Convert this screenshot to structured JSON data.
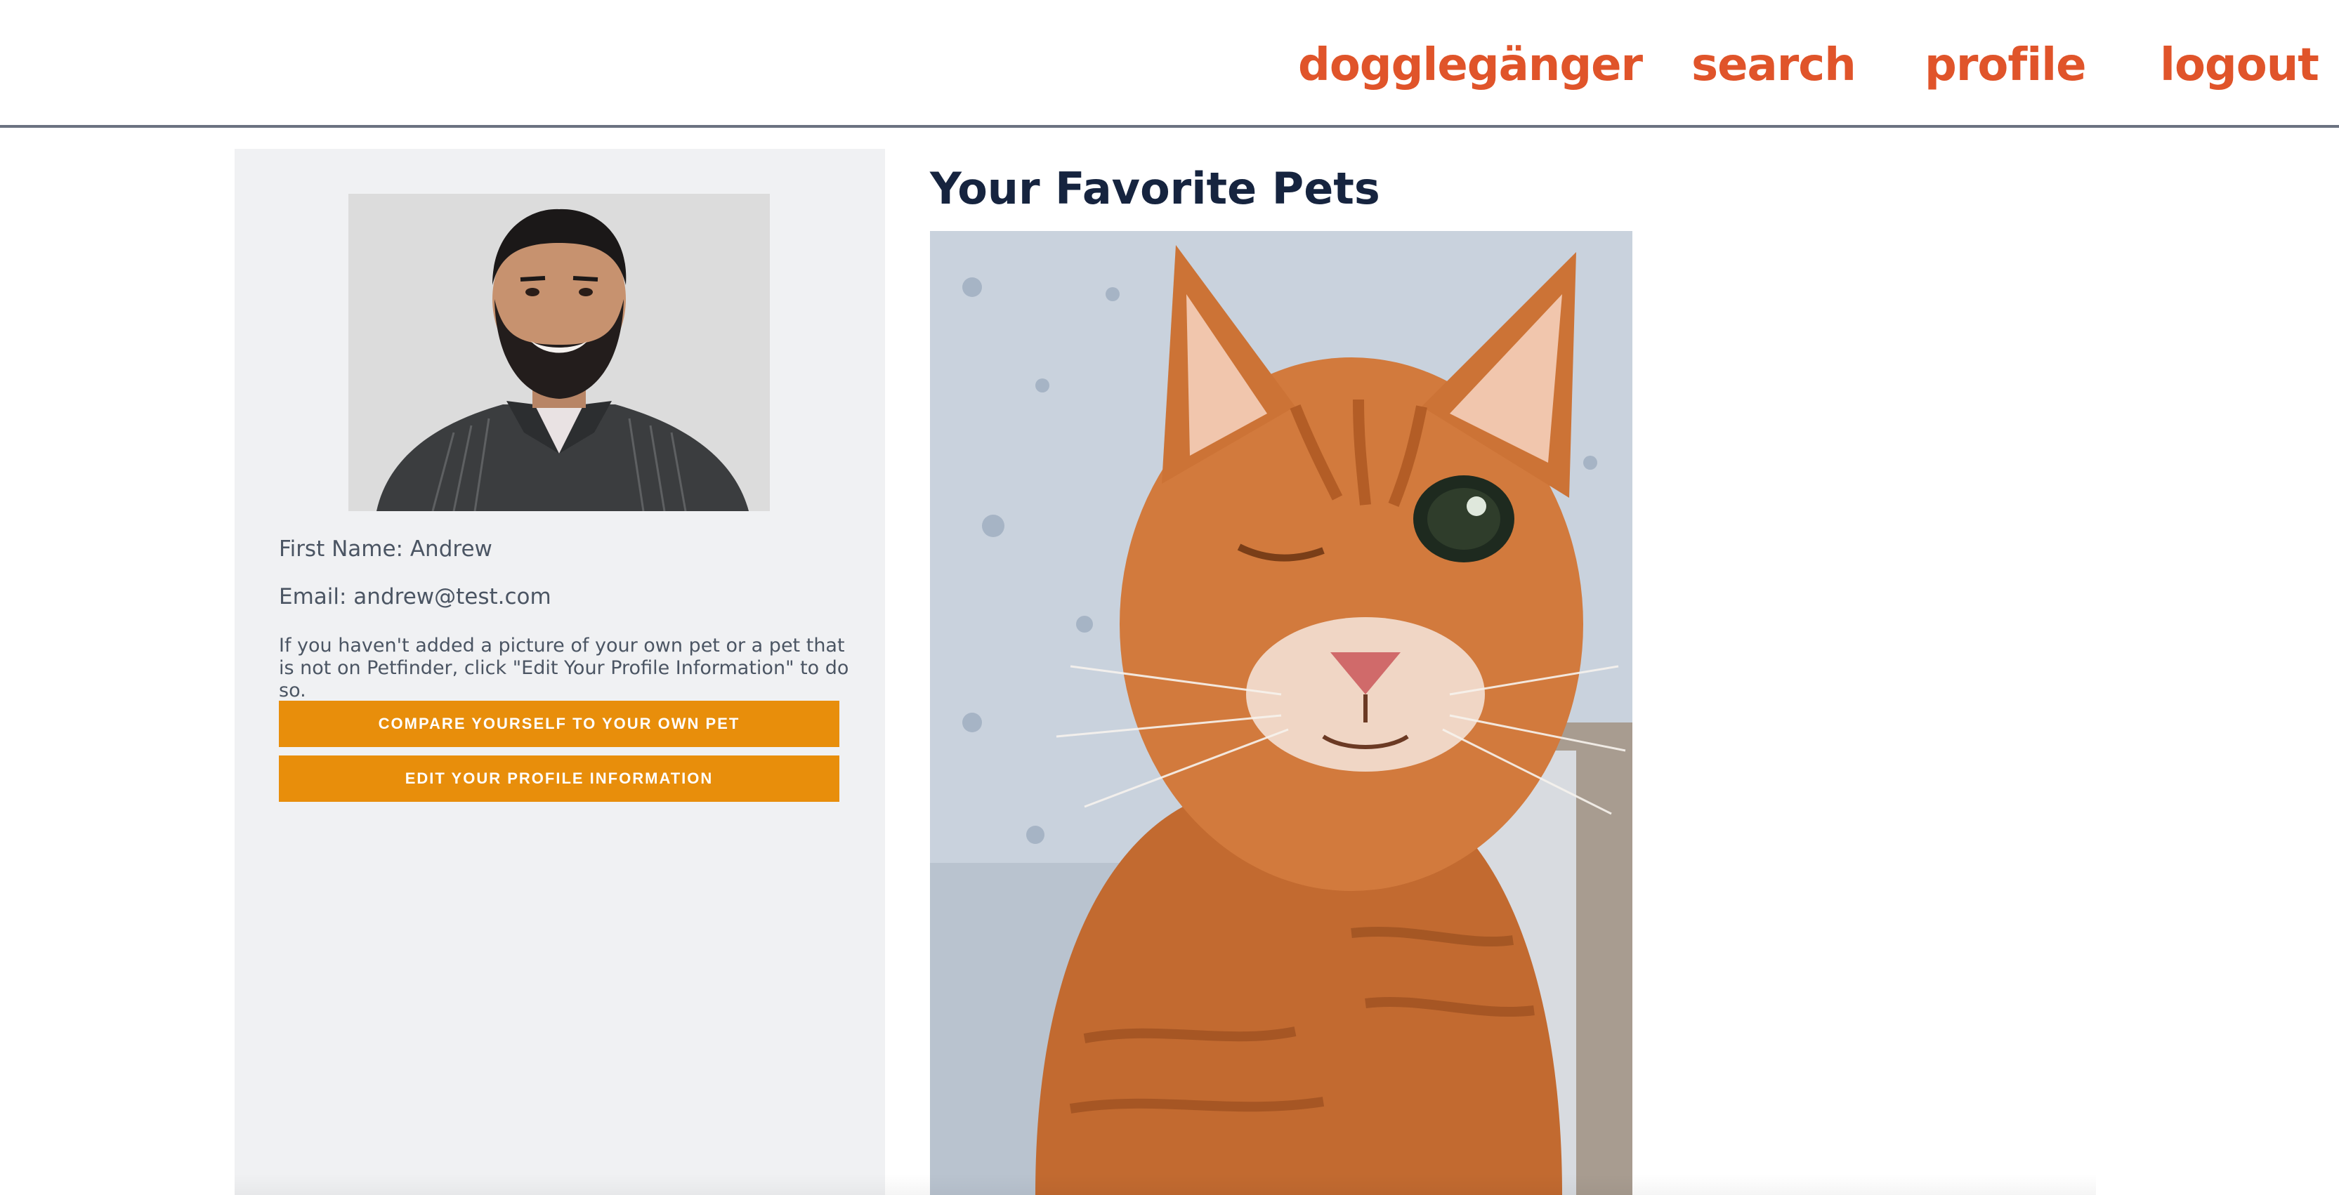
{
  "nav": {
    "brand": "dogglegänger",
    "search": "search",
    "profile": "profile",
    "logout": "logout"
  },
  "profile": {
    "first_name_label": "First Name: Andrew",
    "email_label": "Email: andrew@test.com",
    "note": "If you haven't added a picture of your own pet or a pet that is not on Petfinder, click \"Edit Your Profile Information\" to do so.",
    "compare_button": "COMPARE YOURSELF TO YOUR OWN PET",
    "edit_button": "EDIT YOUR PROFILE INFORMATION"
  },
  "main": {
    "title": "Your Favorite Pets"
  },
  "colors": {
    "nav_accent": "#e0542a",
    "button_orange": "#e88e0b",
    "title_navy": "#16243f",
    "sidebar_bg": "#f0f1f3"
  }
}
